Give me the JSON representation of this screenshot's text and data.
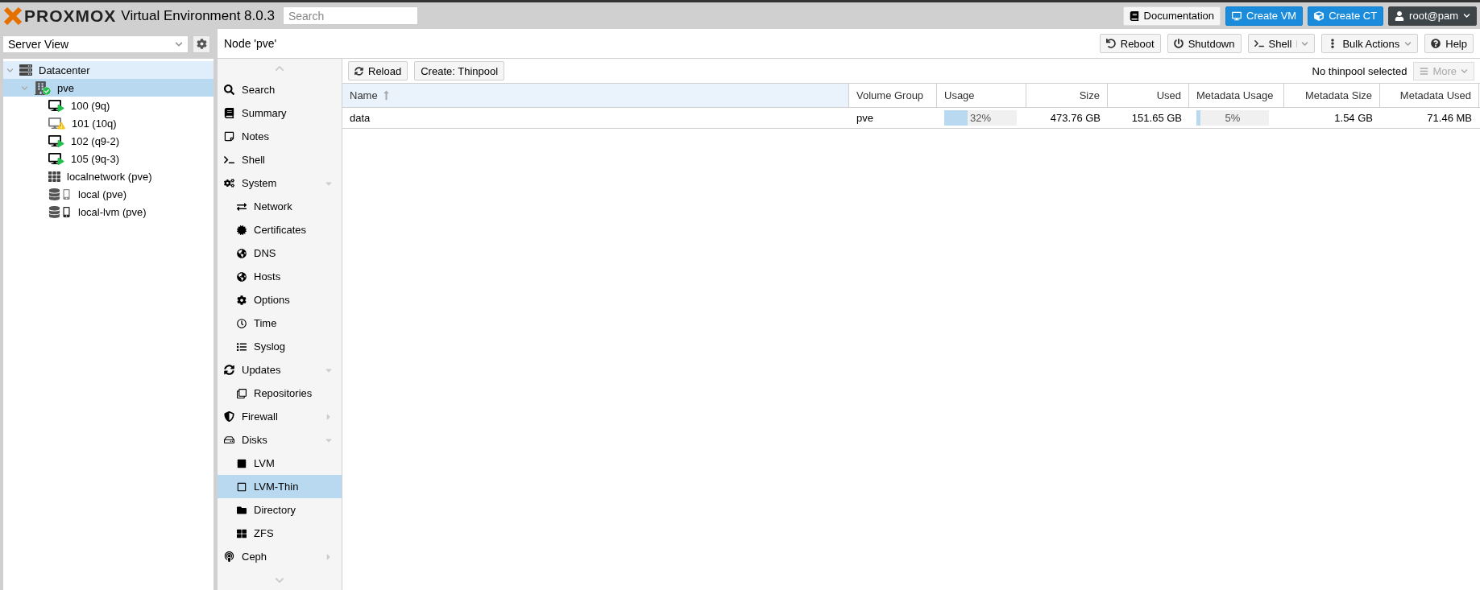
{
  "topbar": {
    "logo": "PROXMOX",
    "version": "Virtual Environment 8.0.3",
    "search": {
      "placeholder": "Search"
    },
    "buttons": [
      {
        "kind": "default",
        "label": "Documentation"
      },
      {
        "kind": "primary",
        "label": "Create VM"
      },
      {
        "kind": "primary",
        "label": "Create CT"
      },
      {
        "kind": "user",
        "label": "root@pam"
      }
    ]
  },
  "view_selector": {
    "value": "Server View"
  },
  "tree": [
    {
      "label": "Datacenter",
      "kind": "datacenter",
      "selected": false,
      "expanded": true,
      "children": [
        {
          "label": "pve",
          "kind": "node",
          "online": true,
          "selected": true,
          "expanded": true,
          "children": [
            {
              "label": "100 (9q)",
              "kind": "vm",
              "running": true,
              "warning": false,
              "selected": false
            },
            {
              "label": "101 (10q)",
              "kind": "vm",
              "running": false,
              "warning": true,
              "selected": false
            },
            {
              "label": "102 (q9-2)",
              "kind": "vm",
              "running": true,
              "warning": false,
              "selected": false
            },
            {
              "label": "105 (9q-3)",
              "kind": "vm",
              "running": true,
              "warning": false,
              "selected": false
            },
            {
              "label": "localnetwork (pve)",
              "kind": "network",
              "selected": false
            },
            {
              "label": "local (pve)",
              "kind": "storage",
              "active": false,
              "selected": false
            },
            {
              "label": "local-lvm (pve)",
              "kind": "storage",
              "active": true,
              "selected": false
            }
          ]
        }
      ]
    }
  ],
  "panel": {
    "title": "Node 'pve'",
    "buttons": [
      {
        "label": "Reboot",
        "kind": "plain"
      },
      {
        "label": "Shutdown",
        "kind": "plain"
      },
      {
        "label": "Shell",
        "kind": "split"
      },
      {
        "label": "Bulk Actions",
        "kind": "menu"
      },
      {
        "label": "Help",
        "kind": "plain"
      }
    ]
  },
  "nav": [
    {
      "label": "Search",
      "selected": false
    },
    {
      "label": "Summary",
      "selected": false
    },
    {
      "label": "Notes",
      "selected": false
    },
    {
      "label": "Shell",
      "selected": false
    },
    {
      "label": "System",
      "selected": false,
      "expanded": true,
      "children": [
        {
          "label": "Network",
          "selected": false
        },
        {
          "label": "Certificates",
          "selected": false
        },
        {
          "label": "DNS",
          "selected": false
        },
        {
          "label": "Hosts",
          "selected": false
        },
        {
          "label": "Options",
          "selected": false
        },
        {
          "label": "Time",
          "selected": false
        },
        {
          "label": "Syslog",
          "selected": false
        }
      ]
    },
    {
      "label": "Updates",
      "selected": false,
      "expanded": true,
      "children": [
        {
          "label": "Repositories",
          "selected": false
        }
      ]
    },
    {
      "label": "Firewall",
      "selected": false,
      "expanded": false
    },
    {
      "label": "Disks",
      "selected": false,
      "expanded": true,
      "children": [
        {
          "label": "LVM",
          "selected": false
        },
        {
          "label": "LVM-Thin",
          "selected": true
        },
        {
          "label": "Directory",
          "selected": false
        },
        {
          "label": "ZFS",
          "selected": false
        }
      ]
    },
    {
      "label": "Ceph",
      "selected": false,
      "expanded": false
    }
  ],
  "toolbar": {
    "buttons": [
      {
        "label": "Reload",
        "kind": "reload"
      },
      {
        "label": "Create: Thinpool",
        "kind": "plain"
      }
    ],
    "status": "No thinpool selected",
    "more": {
      "label": "More",
      "disabled": true
    }
  },
  "table": {
    "columns": [
      {
        "label": "Name",
        "sorted": true
      },
      {
        "label": "Volume Group",
        "sorted": false
      },
      {
        "label": "Usage",
        "sorted": false
      },
      {
        "label": "Size",
        "sorted": false
      },
      {
        "label": "Used",
        "sorted": false
      },
      {
        "label": "Metadata Usage",
        "sorted": false
      },
      {
        "label": "Metadata Size",
        "sorted": false
      },
      {
        "label": "Metadata Used",
        "sorted": false
      }
    ],
    "rows": [
      {
        "selected": false,
        "cells": [
          {
            "kind": "text",
            "text": "data"
          },
          {
            "kind": "text",
            "text": "pve"
          },
          {
            "kind": "bar",
            "level": 0.32,
            "reading": "32%"
          },
          {
            "kind": "text",
            "text": "473.76 GB"
          },
          {
            "kind": "text",
            "text": "151.65 GB"
          },
          {
            "kind": "bar",
            "level": 0.05,
            "reading": "5%"
          },
          {
            "kind": "text",
            "text": "1.54 GB"
          },
          {
            "kind": "text",
            "text": "71.46 MB"
          }
        ]
      }
    ]
  }
}
